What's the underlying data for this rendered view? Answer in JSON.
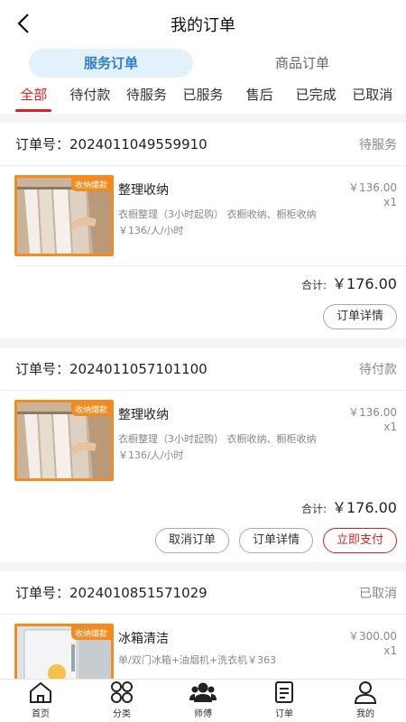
{
  "header": {
    "title": "我的订单"
  },
  "segments": [
    {
      "label": "服务订单"
    },
    {
      "label": "商品订单"
    }
  ],
  "tabs": [
    {
      "label": "全部"
    },
    {
      "label": "待付款"
    },
    {
      "label": "待服务"
    },
    {
      "label": "已服务"
    },
    {
      "label": "售后"
    },
    {
      "label": "已完成"
    },
    {
      "label": "已取消"
    }
  ],
  "orders": [
    {
      "order_no": "订单号：2024011049559910",
      "status": "待服务",
      "badge": "收纳爆款",
      "name": "整理收纳",
      "desc": "衣橱整理（3小时起购） 衣橱收纳、橱柜收纳￥136/人/小时",
      "price": "￥136.00",
      "qty": "x1",
      "total_label": "合计:",
      "total": "￥176.00",
      "buttons": [
        "订单详情"
      ]
    },
    {
      "order_no": "订单号：2024011057101100",
      "status": "待付款",
      "badge": "收纳爆款",
      "name": "整理收纳",
      "desc": "衣橱整理（3小时起购） 衣橱收纳、橱柜收纳￥136/人/小时",
      "price": "￥136.00",
      "qty": "x1",
      "total_label": "合计:",
      "total": "￥176.00",
      "buttons": [
        "取消订单",
        "订单详情",
        "立即支付"
      ]
    },
    {
      "order_no": "订单号：2024010851571029",
      "status": "已取消",
      "badge": "收纳爆款",
      "name": "冰箱清洁",
      "desc": "单/双门冰箱+油烟机+洗衣机￥363",
      "price": "￥300.00",
      "qty": "x1"
    }
  ],
  "nav": [
    {
      "label": "首页",
      "icon": "home-icon"
    },
    {
      "label": "分类",
      "icon": "category-icon"
    },
    {
      "label": "师傅",
      "icon": "workers-icon"
    },
    {
      "label": "订单",
      "icon": "order-icon"
    },
    {
      "label": "我的",
      "icon": "user-icon"
    }
  ],
  "colors": {
    "accent": "#e0201e",
    "segment_active_bg": "#e3f1fb",
    "segment_active_text": "#2f7fcf",
    "badge": "#f58a1f"
  }
}
